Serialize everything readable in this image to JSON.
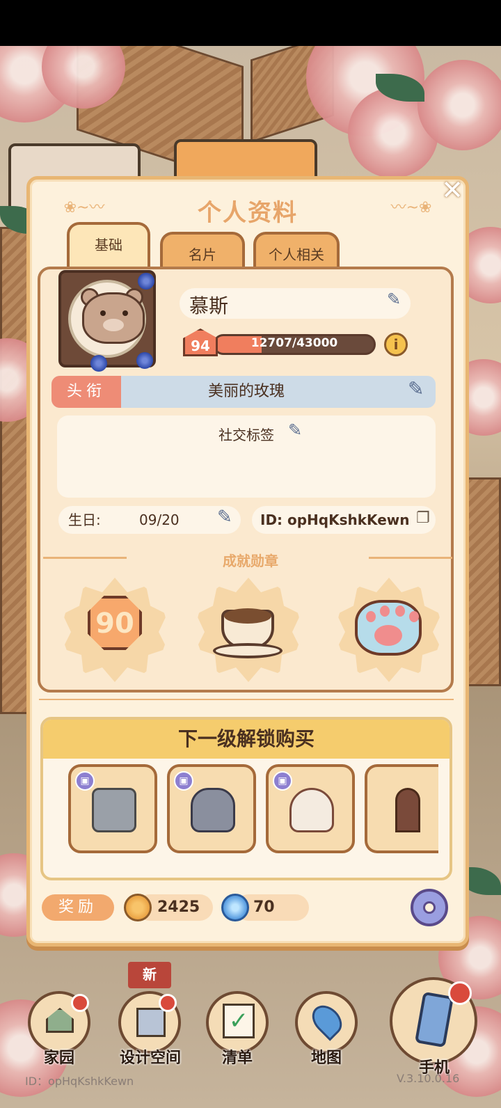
{
  "panel": {
    "title": "个人资料",
    "tabs": [
      {
        "label": "基础",
        "active": true
      },
      {
        "label": "名片",
        "active": false
      },
      {
        "label": "个人相关",
        "active": false
      }
    ]
  },
  "profile": {
    "name": "慕斯",
    "level": "94",
    "xp_text": "12707/43000",
    "xp_fraction": 0.2955,
    "title_label": "头衔",
    "title_value": "美丽的玫瑰",
    "social_tags_label": "社交标签",
    "birthday_label": "生日:",
    "birthday_value": "09/20",
    "id_text": "ID: opHqKshkKewn"
  },
  "achievements": {
    "label": "成就勋章",
    "medals": [
      {
        "name": "level-90-medal",
        "text": "90"
      },
      {
        "name": "coffee-medal"
      },
      {
        "name": "paw-medal"
      }
    ]
  },
  "unlock": {
    "title": "下一级解锁购买",
    "items": [
      "fryer",
      "armchair",
      "stand-mixer",
      "shelf"
    ]
  },
  "rewards": {
    "label": "奖励",
    "coins": "2425",
    "gems": "70"
  },
  "nav": {
    "new_badge": "新",
    "items": [
      {
        "label": "家园"
      },
      {
        "label": "设计空间"
      },
      {
        "label": "清单"
      },
      {
        "label": "地图"
      },
      {
        "label": "手机"
      }
    ]
  },
  "footer": {
    "id": "ID：opHqKshkKewn",
    "version": "V.3.10.0.16"
  },
  "colors": {
    "panel_bg": "#fdf1dc",
    "accent_orange": "#f07e5e",
    "title_blue": "#cddbe7"
  }
}
